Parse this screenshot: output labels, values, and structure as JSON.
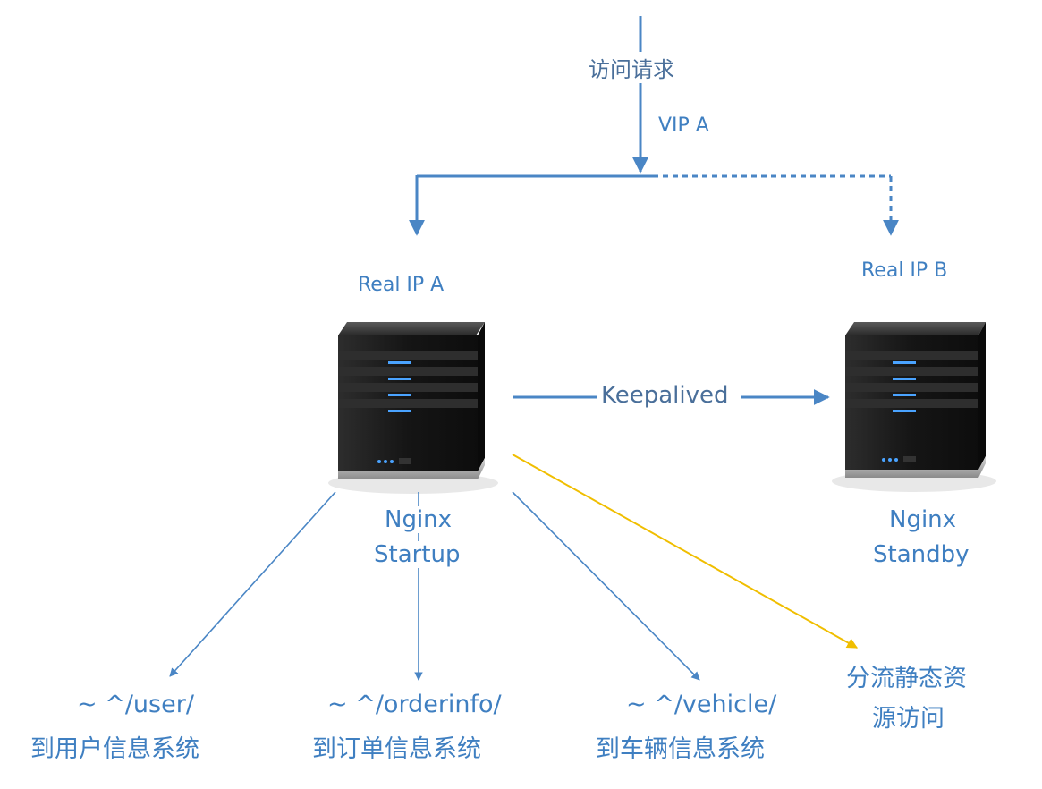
{
  "request_label": "访问请求",
  "vip_label": "VIP A",
  "primary": {
    "real_ip": "Real IP A",
    "name_line1": "Nginx",
    "name_line2": "Startup"
  },
  "standby": {
    "real_ip": "Real IP B",
    "name_line1": "Nginx",
    "name_line2": "Standby"
  },
  "keepalived_label": "Keepalived",
  "routes": [
    {
      "pattern": "~ ^/user/",
      "target": "到用户信息系统"
    },
    {
      "pattern": "~ ^/orderinfo/",
      "target": "到订单信息系统"
    },
    {
      "pattern": "~ ^/vehicle/",
      "target": "到车辆信息系统"
    }
  ],
  "static_route": {
    "line1": "分流静态资",
    "line2": "源访问"
  },
  "colors": {
    "line_blue": "#4a86c5",
    "line_yellow": "#f0be00",
    "text_blue": "#3f7fc1",
    "text_gray_blue": "#4a6f9a",
    "server_body": "#1b1b1b",
    "server_led": "#4aa3ff"
  }
}
